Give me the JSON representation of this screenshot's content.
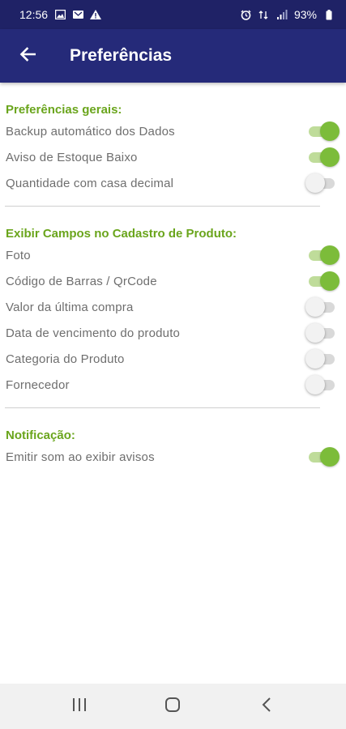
{
  "status_bar": {
    "time": "12:56",
    "battery": "93%"
  },
  "app_bar": {
    "title": "Preferências"
  },
  "sections": [
    {
      "title": "Preferências gerais:",
      "items": [
        {
          "label": "Backup automático dos Dados",
          "enabled": true
        },
        {
          "label": "Aviso de Estoque Baixo",
          "enabled": true
        },
        {
          "label": "Quantidade com casa decimal",
          "enabled": false
        }
      ]
    },
    {
      "title": "Exibir Campos no Cadastro de Produto:",
      "items": [
        {
          "label": "Foto",
          "enabled": true
        },
        {
          "label": "Código de Barras / QrCode",
          "enabled": true
        },
        {
          "label": "Valor da última compra",
          "enabled": false
        },
        {
          "label": "Data de vencimento do produto",
          "enabled": false
        },
        {
          "label": "Categoria do Produto",
          "enabled": false
        },
        {
          "label": "Fornecedor",
          "enabled": false
        }
      ]
    },
    {
      "title": "Notificação:",
      "items": [
        {
          "label": "Emitir som ao exibir avisos",
          "enabled": true
        }
      ]
    }
  ],
  "colors": {
    "app_bar": "#252a79",
    "status_bar": "#1f2266",
    "accent_green": "#6aa51c",
    "toggle_on_thumb": "#7cbc3a",
    "toggle_on_track": "#bfdc9a"
  }
}
